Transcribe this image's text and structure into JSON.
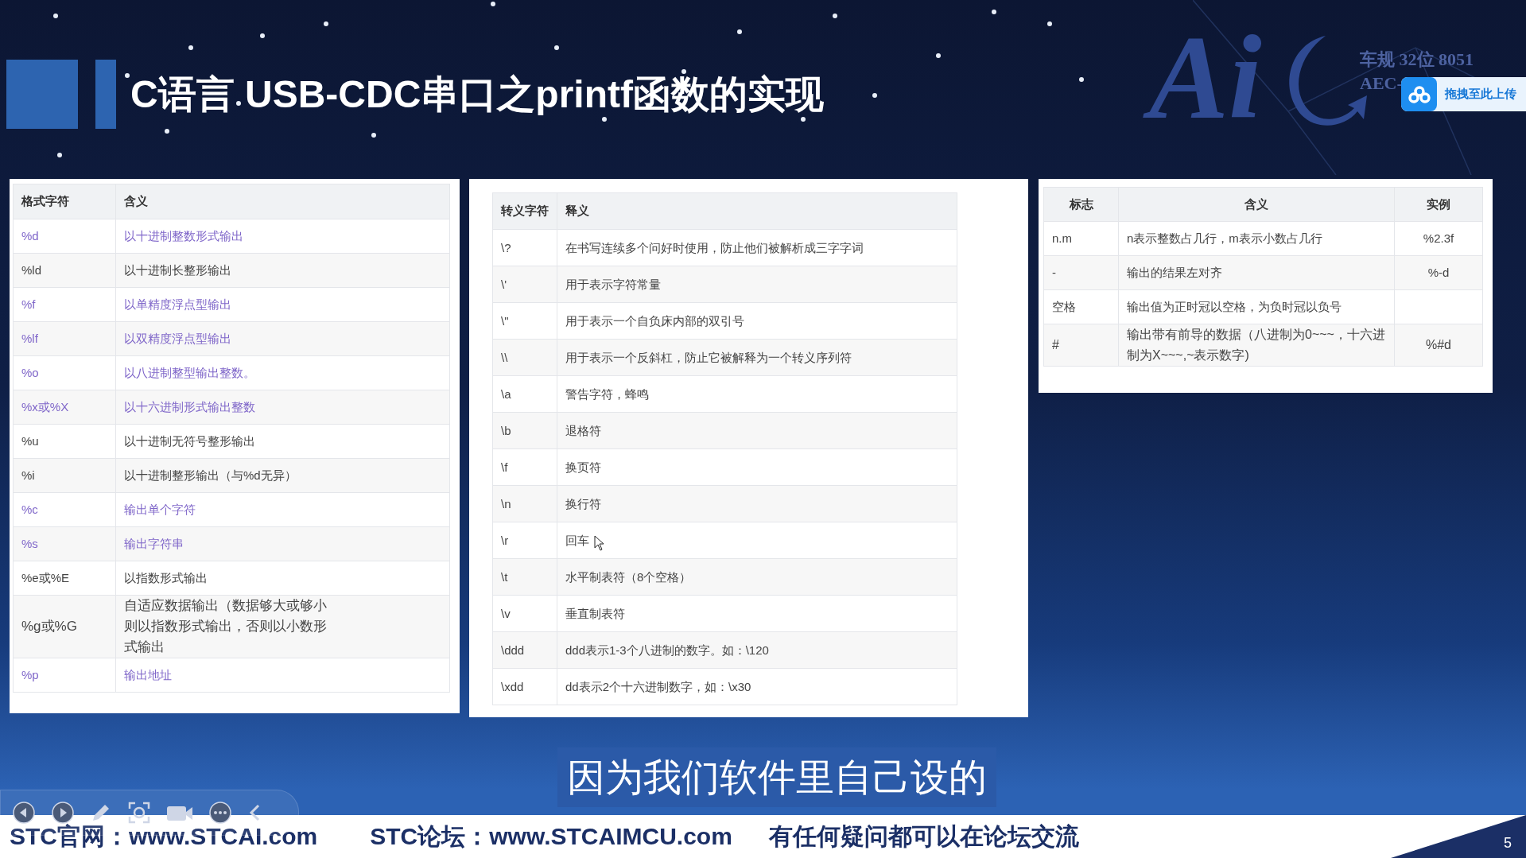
{
  "slide": {
    "title": "C语言 USB-CDC串口之printf函数的实现",
    "page_number": "5"
  },
  "logo": {
    "mark": "Ai",
    "line_1": "车规 32位 8051",
    "line_2": "AEC-"
  },
  "upload_button": {
    "label": "拖拽至此上传"
  },
  "tables": [
    {
      "columns": [
        "格式字符",
        "含义"
      ],
      "rows": [
        {
          "cells": [
            "%d",
            "以十进制整数形式输出"
          ],
          "color": "#7f66c9"
        },
        {
          "cells": [
            "%ld",
            "以十进制长整形输出"
          ],
          "color": "#444444"
        },
        {
          "cells": [
            "%f",
            "以单精度浮点型输出"
          ],
          "color": "#7f66c9"
        },
        {
          "cells": [
            "%lf",
            "以双精度浮点型输出"
          ],
          "color": "#7f66c9"
        },
        {
          "cells": [
            "%o",
            "以八进制整型输出整数。"
          ],
          "color": "#7f66c9"
        },
        {
          "cells": [
            "%x或%X",
            "以十六进制形式输出整数"
          ],
          "color": "#7f66c9"
        },
        {
          "cells": [
            "%u",
            "以十进制无符号整形输出"
          ],
          "color": "#444444"
        },
        {
          "cells": [
            "%i",
            "以十进制整形输出（与%d无异）"
          ],
          "color": "#444444"
        },
        {
          "cells": [
            "%c",
            "输出单个字符"
          ],
          "color": "#7f66c9"
        },
        {
          "cells": [
            "%s",
            "输出字符串"
          ],
          "color": "#7f66c9"
        },
        {
          "cells": [
            "%e或%E",
            "以指数形式输出"
          ],
          "color": "#444444"
        },
        {
          "cells": [
            "%g或%G",
            "自适应数据输出（数据够大或够小则以指数形式输出，否则以小数形式输出"
          ],
          "color": "#444444"
        },
        {
          "cells": [
            "%p",
            "输出地址"
          ],
          "color": "#7f66c9"
        }
      ]
    },
    {
      "columns": [
        "转义字符",
        "释义"
      ],
      "rows": [
        {
          "cells": [
            "\\?",
            "在书写连续多个问好时使用，防止他们被解析成三字字词"
          ]
        },
        {
          "cells": [
            "\\'",
            "用于表示字符常量"
          ]
        },
        {
          "cells": [
            "\\\"",
            "用于表示一个自负床内部的双引号"
          ]
        },
        {
          "cells": [
            "\\\\",
            "用于表示一个反斜杠，防止它被解释为一个转义序列符"
          ]
        },
        {
          "cells": [
            "\\a",
            "警告字符，蜂鸣"
          ]
        },
        {
          "cells": [
            "\\b",
            "退格符"
          ]
        },
        {
          "cells": [
            "\\f",
            "换页符"
          ]
        },
        {
          "cells": [
            "\\n",
            "换行符"
          ]
        },
        {
          "cells": [
            "\\r",
            "回车"
          ]
        },
        {
          "cells": [
            "\\t",
            "水平制表符（8个空格）"
          ]
        },
        {
          "cells": [
            "\\v",
            "垂直制表符"
          ]
        },
        {
          "cells": [
            "\\ddd",
            "ddd表示1-3个八进制的数字。如：\\120"
          ]
        },
        {
          "cells": [
            "\\xdd",
            "dd表示2个十六进制数字，如：\\x30"
          ]
        }
      ]
    },
    {
      "columns": [
        "标志",
        "含义",
        "实例"
      ],
      "rows": [
        {
          "cells": [
            "n.m",
            "n表示整数占几行，m表示小数占几行",
            "%2.3f"
          ]
        },
        {
          "cells": [
            "-",
            "输出的结果左对齐",
            "%-d"
          ]
        },
        {
          "cells": [
            "空格",
            "输出值为正时冠以空格，为负时冠以负号",
            ""
          ]
        },
        {
          "cells": [
            "#",
            "输出带有前导的数据（八进制为0~~~，十六进制为X~~~,~表示数字)",
            "%#d"
          ]
        }
      ]
    }
  ],
  "subtitle": "因为我们软件里自己设的",
  "footer": [
    "STC官网：www.STCAI.com",
    "STC论坛：www.STCAIMCU.com",
    "有任何疑问都可以在论坛交流"
  ]
}
